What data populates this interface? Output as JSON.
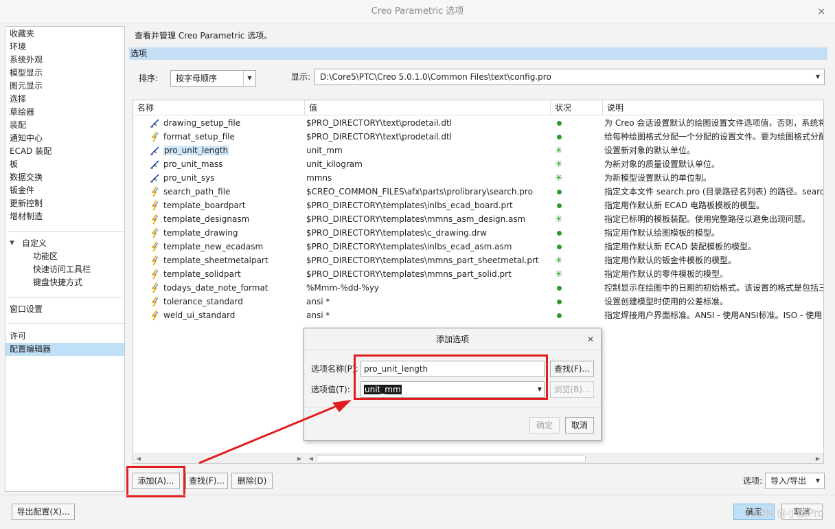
{
  "window": {
    "title": "Creo Parametric 选项",
    "close_glyph": "×"
  },
  "sidebar": {
    "items": [
      "收藏夹",
      "环境",
      "系统外观",
      "模型显示",
      "图元显示",
      "选择",
      "草绘器",
      "装配",
      "通知中心",
      "ECAD 装配",
      "板",
      "数据交换",
      "钣金件",
      "更新控制",
      "增材制造"
    ],
    "custom_header": "自定义",
    "custom_items": [
      "功能区",
      "快速访问工具栏",
      "键盘快捷方式"
    ],
    "window_settings": "窗口设置",
    "license": "许可",
    "config_editor": "配置编辑器"
  },
  "main": {
    "heading": "查看并管理 Creo Parametric 选项。",
    "section": "选项",
    "sort_label": "排序:",
    "sort_value": "按字母顺序",
    "show_label": "显示:",
    "show_value": "D:\\Core5\\PTC\\Creo 5.0.1.0\\Common Files\\text\\config.pro"
  },
  "table": {
    "columns": [
      "名称",
      "值",
      "状况",
      "说明"
    ],
    "rows": [
      {
        "name": "drawing_setup_file",
        "value": "$PRO_DIRECTORY\\text\\prodetail.dtl",
        "status": "dot",
        "desc": "为 Creo 会话设置默认的绘图设置文件选项值，否则，系统将",
        "icon": "pen"
      },
      {
        "name": "format_setup_file",
        "value": "$PRO_DIRECTORY\\text\\prodetail.dtl",
        "status": "dot",
        "desc": "给每种绘图格式分配一个分配的设置文件。要为绘图格式分配",
        "icon": "bolt"
      },
      {
        "name": "pro_unit_length",
        "value": "unit_mm",
        "status": "star",
        "desc": "设置新对象的默认单位。",
        "icon": "pen",
        "selected": true
      },
      {
        "name": "pro_unit_mass",
        "value": "unit_kilogram",
        "status": "star",
        "desc": "为新对象的质量设置默认单位。",
        "icon": "pen"
      },
      {
        "name": "pro_unit_sys",
        "value": "mmns",
        "status": "star",
        "desc": "为新模型设置默认的单位制。",
        "icon": "pen"
      },
      {
        "name": "search_path_file",
        "value": "$CREO_COMMON_FILES\\afx\\parts\\prolibrary\\search.pro",
        "status": "dot",
        "desc": "指定文本文件 search.pro (目录路径名列表) 的路径。search",
        "icon": "bolt"
      },
      {
        "name": "template_boardpart",
        "value": "$PRO_DIRECTORY\\templates\\inlbs_ecad_board.prt",
        "status": "dot",
        "desc": "指定用作默认新 ECAD 电路板模板的模型。",
        "icon": "bolt"
      },
      {
        "name": "template_designasm",
        "value": "$PRO_DIRECTORY\\templates\\mmns_asm_design.asm",
        "status": "star",
        "desc": "指定已标明的模板装配。使用完整路径以避免出现问题。",
        "icon": "bolt"
      },
      {
        "name": "template_drawing",
        "value": "$PRO_DIRECTORY\\templates\\c_drawing.drw",
        "status": "dot",
        "desc": "指定用作默认绘图模板的模型。",
        "icon": "bolt"
      },
      {
        "name": "template_new_ecadasm",
        "value": "$PRO_DIRECTORY\\templates\\inlbs_ecad_asm.asm",
        "status": "dot",
        "desc": "指定用作默认新 ECAD 装配模板的模型。",
        "icon": "bolt"
      },
      {
        "name": "template_sheetmetalpart",
        "value": "$PRO_DIRECTORY\\templates\\mmns_part_sheetmetal.prt",
        "status": "star",
        "desc": "指定用作默认的钣金件模板的模型。",
        "icon": "bolt"
      },
      {
        "name": "template_solidpart",
        "value": "$PRO_DIRECTORY\\templates\\mmns_part_solid.prt",
        "status": "star",
        "desc": "指定用作默认的零件模板的模型。",
        "icon": "bolt"
      },
      {
        "name": "todays_date_note_format",
        "value": "%Mmm-%dd-%yy",
        "status": "dot",
        "desc": "控制显示在绘图中的日期的初始格式。该设置的格式是包括三",
        "icon": "bolt"
      },
      {
        "name": "tolerance_standard",
        "value": "ansi *",
        "status": "dot",
        "desc": "设置创建模型时使用的公差标准。",
        "icon": "bolt"
      },
      {
        "name": "weld_ui_standard",
        "value": "ansi *",
        "status": "dot",
        "desc": "指定焊接用户界面标准。ANSI - 使用ANSI标准。ISO - 使用",
        "icon": "bolt"
      }
    ]
  },
  "dialog": {
    "title": "添加选项",
    "name_label": "选项名称(P):",
    "name_value": "pro_unit_length",
    "value_label": "选项值(T):",
    "value_value": "unit_mm",
    "find_button": "查找(F)...",
    "browse_button": "浏览(B)...",
    "ok_button": "确定",
    "cancel_button": "取消"
  },
  "bottom": {
    "add_button": "添加(A)...",
    "find_button": "查找(F)...",
    "delete_button": "删除(D)",
    "options_label": "选项:",
    "options_value": "导入/导出",
    "export_button": "导出配置(X)...",
    "ok_button": "确定",
    "cancel_button": "取消"
  },
  "watermark": "CSDN @小猷Pro",
  "colors": {
    "accent": "#bfe0f6",
    "section": "#c4dff5",
    "annotation": "#e11d1d",
    "status_green": "#2e9a2e"
  },
  "icons": {
    "pen": "pen-icon",
    "bolt": "bolt-icon",
    "dot": "status-dot-icon",
    "star": "status-star-icon"
  }
}
